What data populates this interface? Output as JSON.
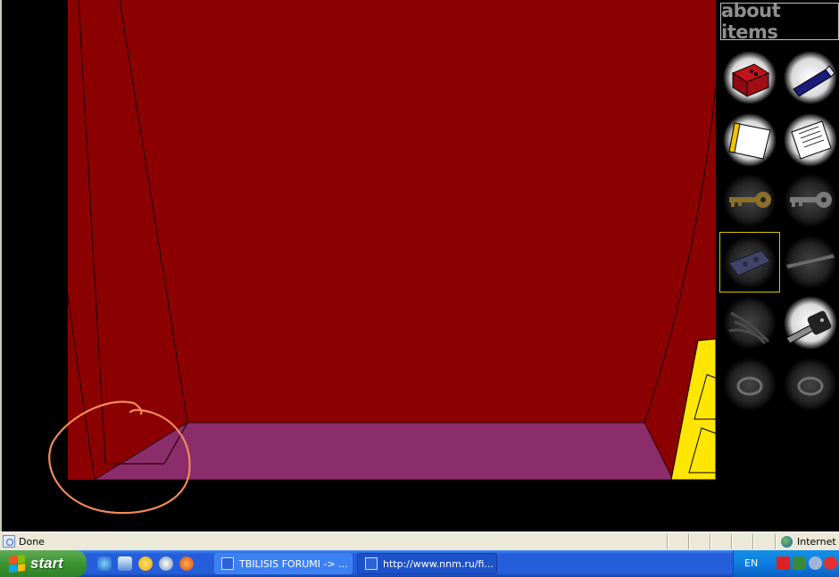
{
  "browser": {
    "status_text": "Done",
    "zone_text": "Internet"
  },
  "game": {
    "inventory_title": "about items",
    "inventory": [
      {
        "name": "red-box",
        "state": "owned"
      },
      {
        "name": "flashlight",
        "state": "owned"
      },
      {
        "name": "paper",
        "state": "owned"
      },
      {
        "name": "note",
        "state": "owned"
      },
      {
        "name": "gold-key",
        "state": "owned"
      },
      {
        "name": "silver-key",
        "state": "owned"
      },
      {
        "name": "button-panel",
        "state": "selected"
      },
      {
        "name": "metal-bar",
        "state": "owned"
      },
      {
        "name": "wires",
        "state": "owned"
      },
      {
        "name": "car-key",
        "state": "owned"
      },
      {
        "name": "ring",
        "state": "owned"
      },
      {
        "name": "ring",
        "state": "owned"
      }
    ],
    "colors": {
      "wall": "#8b0000",
      "floor": "#8b2d6b",
      "drawer": "#ffe600",
      "highlight_circle": "#f28a5a",
      "selected_outline": "#d8c400"
    }
  },
  "taskbar": {
    "start_label": "start",
    "quick_launch": [
      "ie-icon",
      "outlook-icon",
      "messenger-icon",
      "media-icon",
      "firefox-icon"
    ],
    "tasks": [
      {
        "label": "TBILISIS FORUMI -> ..."
      },
      {
        "label": "http://www.nnm.ru/fi..."
      }
    ],
    "language": "EN"
  }
}
